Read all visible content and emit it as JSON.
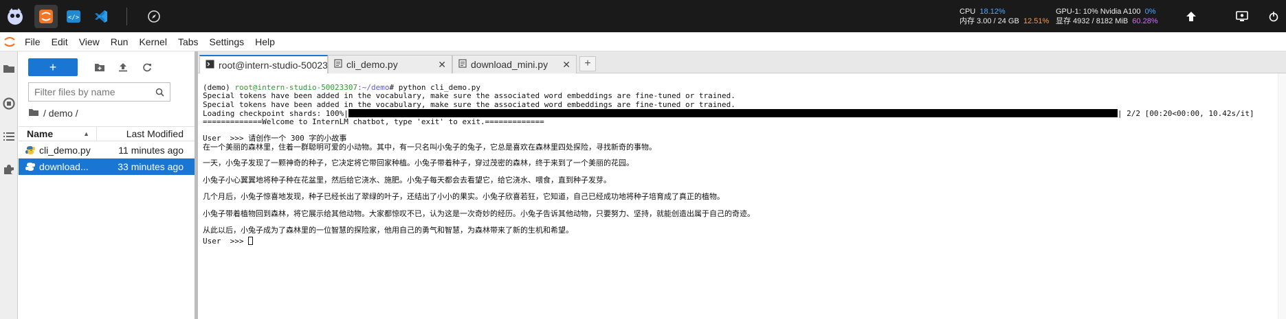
{
  "topbar": {
    "sysinfo": {
      "cpu_label": "CPU",
      "cpu_value": "18.12%",
      "gpu_label": "GPU-1: 10% Nvidia A100",
      "gpu_value": "0%",
      "mem_label": "内存 3.00 / 24 GB",
      "mem_value": "12.51%",
      "vram_label": "显存 4932 / 8182 MiB",
      "vram_value": "60.28%"
    }
  },
  "menu": [
    "File",
    "Edit",
    "View",
    "Run",
    "Kernel",
    "Tabs",
    "Settings",
    "Help"
  ],
  "filebrowser": {
    "new_label": "+",
    "filter_placeholder": "Filter files by name",
    "breadcrumb": "/ demo /",
    "col_name": "Name",
    "col_modified": "Last Modified",
    "files": [
      {
        "name": "cli_demo.py",
        "modified": "11 minutes ago"
      },
      {
        "name": "download...",
        "modified": "33 minutes ago"
      }
    ]
  },
  "tabs": [
    {
      "label": "root@intern-studio-50023"
    },
    {
      "label": "cli_demo.py"
    },
    {
      "label": "download_mini.py"
    }
  ],
  "terminal": {
    "prompt_env": "(demo) ",
    "prompt_user": "root@intern-studio-50023307",
    "prompt_path": ":~/demo",
    "prompt_cmd": "# python cli_demo.py",
    "line_special1": "Special tokens have been added in the vocabulary, make sure the associated word embeddings are fine-tuned or trained.",
    "line_special2": "Special tokens have been added in the vocabulary, make sure the associated word embeddings are fine-tuned or trained.",
    "loading_prefix": "Loading checkpoint shards: 100%|",
    "loading_suffix": "| 2/2 [00:20<00:00, 10.42s/it]",
    "welcome": "=============Welcome to InternLM chatbot, type 'exit' to exit.=============",
    "user_prompt": "User  >>> 请创作一个 300 字的小故事",
    "story": [
      "在一个美丽的森林里，住着一群聪明可爱的小动物。其中，有一只名叫小兔子的兔子，它总是喜欢在森林里四处探险，寻找新奇的事物。",
      "一天，小兔子发现了一颗神奇的种子，它决定将它带回家种植。小兔子带着种子，穿过茂密的森林，终于来到了一个美丽的花园。",
      "小兔子小心翼翼地将种子种在花盆里，然后给它浇水、施肥。小兔子每天都会去看望它，给它浇水、喂食，直到种子发芽。",
      "几个月后，小兔子惊喜地发现，种子已经长出了翠绿的叶子，还结出了小小的果实。小兔子欣喜若狂，它知道，自己已经成功地将种子培育成了真正的植物。",
      "小兔子带着植物回到森林，将它展示给其他动物。大家都惊叹不已，认为这是一次奇妙的经历。小兔子告诉其他动物，只要努力、坚持，就能创造出属于自己的奇迹。",
      "从此以后，小兔子成为了森林里的一位智慧的探险家，他用自己的勇气和智慧，为森林带来了新的生机和希望。"
    ],
    "final_prompt": "User  >>> "
  }
}
